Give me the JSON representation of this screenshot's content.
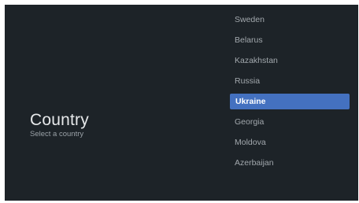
{
  "title": "Country",
  "subtitle": "Select a country",
  "countries": [
    {
      "label": "Sweden",
      "selected": false
    },
    {
      "label": "Belarus",
      "selected": false
    },
    {
      "label": "Kazakhstan",
      "selected": false
    },
    {
      "label": "Russia",
      "selected": false
    },
    {
      "label": "Ukraine",
      "selected": true
    },
    {
      "label": "Georgia",
      "selected": false
    },
    {
      "label": "Moldova",
      "selected": false
    },
    {
      "label": "Azerbaijan",
      "selected": false
    }
  ],
  "colors": {
    "background": "#1d2328",
    "accent": "#4471c0"
  }
}
